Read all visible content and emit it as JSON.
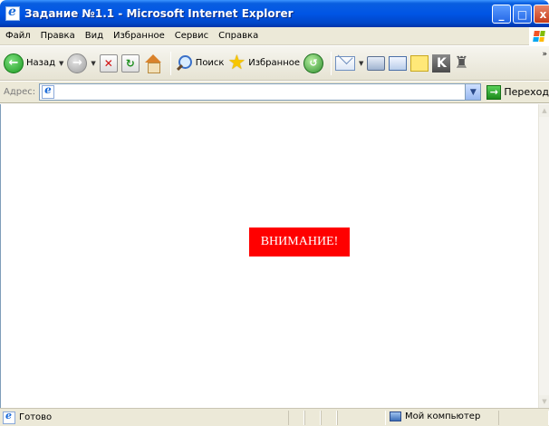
{
  "window": {
    "title": "Задание №1.1 - Microsoft Internet Explorer",
    "minimize": "_",
    "maximize": "□",
    "close": "x"
  },
  "menu": {
    "items": [
      "Файл",
      "Правка",
      "Вид",
      "Избранное",
      "Сервис",
      "Справка"
    ]
  },
  "toolbar": {
    "back_label": "Назад",
    "search_label": "Поиск",
    "favorites_label": "Избранное"
  },
  "address": {
    "label": "Адрес:",
    "value": "",
    "go_label": "Переход"
  },
  "content": {
    "banner_text": "ВНИМАНИЕ!",
    "banner_color": "#ff0000"
  },
  "status": {
    "text": "Готово",
    "zone": "Мой компьютер"
  }
}
